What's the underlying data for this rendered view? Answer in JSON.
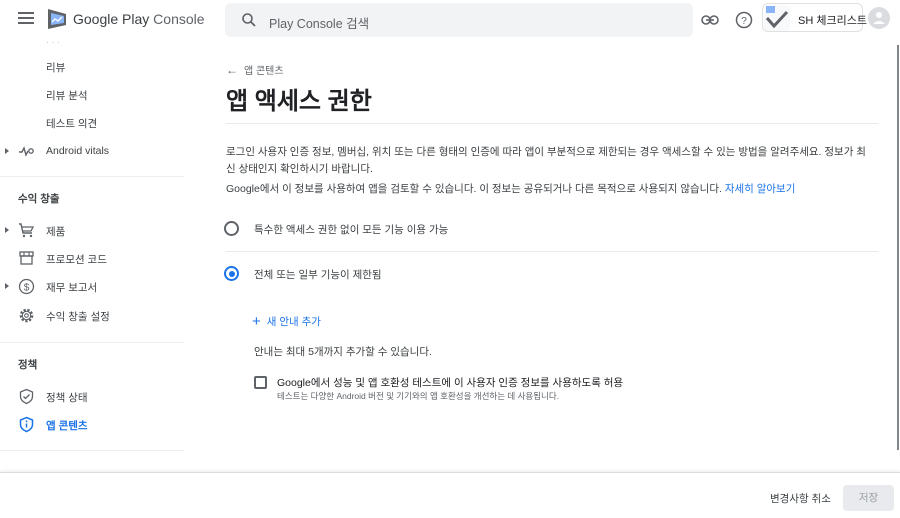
{
  "header": {
    "logo_google_play": "Google Play",
    "logo_console": "Console",
    "search_placeholder": "Play Console 검색",
    "app_name": "SH 체크리스트"
  },
  "sidebar": {
    "items_top": [
      {
        "label": "리뷰"
      },
      {
        "label": "리뷰 분석"
      },
      {
        "label": "테스트 의견"
      },
      {
        "label": "Android vitals",
        "icon": "vitals-icon",
        "expandable": true
      }
    ],
    "sections": [
      {
        "title": "수익 창출",
        "items": [
          {
            "label": "제품",
            "icon": "cart-icon",
            "expandable": true
          },
          {
            "label": "프로모션 코드",
            "icon": "store-icon",
            "expandable": false
          },
          {
            "label": "재무 보고서",
            "icon": "dollar-icon",
            "expandable": true
          },
          {
            "label": "수익 창출 설정",
            "icon": "gear-icon",
            "expandable": false
          }
        ]
      },
      {
        "title": "정책",
        "items": [
          {
            "label": "정책 상태",
            "icon": "shield-check-icon",
            "expandable": false
          },
          {
            "label": "앱 콘텐츠",
            "icon": "shield-info-icon",
            "expandable": false,
            "active": true
          }
        ]
      }
    ]
  },
  "main": {
    "breadcrumb": "앱 콘텐츠",
    "title": "앱 액세스 권한",
    "description": "로그인 사용자 인증 정보, 멤버십, 위치 또는 다른 형태의 인증에 따라 앱이 부분적으로 제한되는 경우 액세스할 수 있는 방법을 알려주세요. 정보가 최신 상태인지 확인하시기 바랍니다.",
    "usage_note": "Google에서 이 정보를 사용하여 앱을 검토할 수 있습니다. 이 정보는 공유되거나 다른 목적으로 사용되지 않습니다.",
    "learn_more": "자세히 알아보기",
    "options": [
      {
        "label": "특수한 액세스 권한 없이 모든 기능 이용 가능",
        "selected": false
      },
      {
        "label": "전체 또는 일부 기능이 제한됨",
        "selected": true
      }
    ],
    "add_instruction": "새 안내 추가",
    "limit_hint": "안내는 최대 5개까지 추가할 수 있습니다.",
    "checkbox": {
      "label": "Google에서 성능 및 앱 호환성 테스트에 이 사용자 인증 정보를 사용하도록 허용",
      "sublabel": "테스트는 다양한 Android 버전 및 기기와의 앱 호환성을 개선하는 데 사용됩니다.",
      "checked": false
    }
  },
  "footer": {
    "discard": "변경사항 취소",
    "save": "저장"
  },
  "colors": {
    "accent": "#1a73e8",
    "text": "#3c4043",
    "muted": "#5f6368"
  }
}
